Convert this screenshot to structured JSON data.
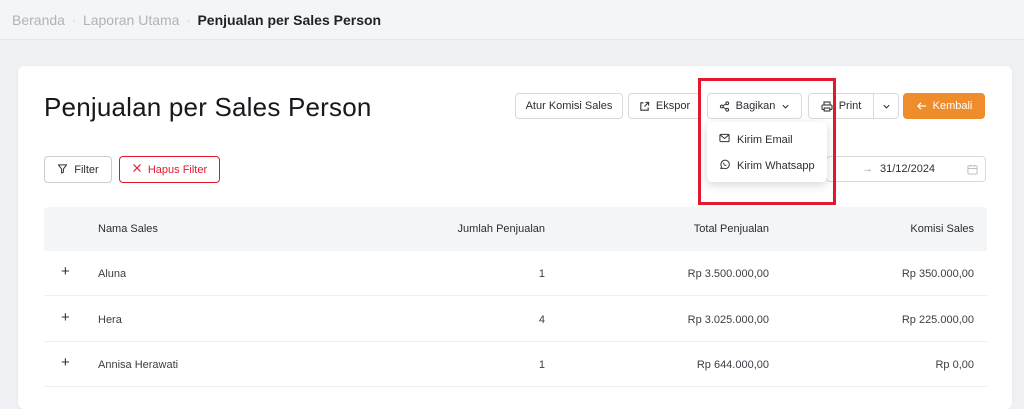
{
  "breadcrumb": {
    "items": [
      "Beranda",
      "Laporan Utama"
    ],
    "current": "Penjualan per Sales Person",
    "separator": "·"
  },
  "page": {
    "title": "Penjualan per Sales Person"
  },
  "toolbar": {
    "atur_komisi": "Atur Komisi Sales",
    "ekspor": "Ekspor",
    "bagikan": "Bagikan",
    "print": "Print",
    "kembali": "Kembali"
  },
  "share_menu": {
    "items": [
      {
        "label": "Kirim Email",
        "icon": "mail-icon"
      },
      {
        "label": "Kirim Whatsapp",
        "icon": "whatsapp-icon"
      }
    ]
  },
  "filters": {
    "filter_label": "Filter",
    "clear_label": "Hapus Filter",
    "date_arrow": "→",
    "date_end": "31/12/2024"
  },
  "table": {
    "columns": [
      "Nama Sales",
      "Jumlah Penjualan",
      "Total Penjualan",
      "Komisi Sales"
    ],
    "rows": [
      {
        "name": "Aluna",
        "count": "1",
        "total": "Rp 3.500.000,00",
        "commission": "Rp 350.000,00"
      },
      {
        "name": "Hera",
        "count": "4",
        "total": "Rp 3.025.000,00",
        "commission": "Rp 225.000,00"
      },
      {
        "name": "Annisa Herawati",
        "count": "1",
        "total": "Rp 644.000,00",
        "commission": "Rp 0,00"
      }
    ],
    "expand_symbol": "+"
  },
  "colors": {
    "accent": "#ef8d2c",
    "danger": "#e3182d",
    "highlight": "#e3182d"
  }
}
